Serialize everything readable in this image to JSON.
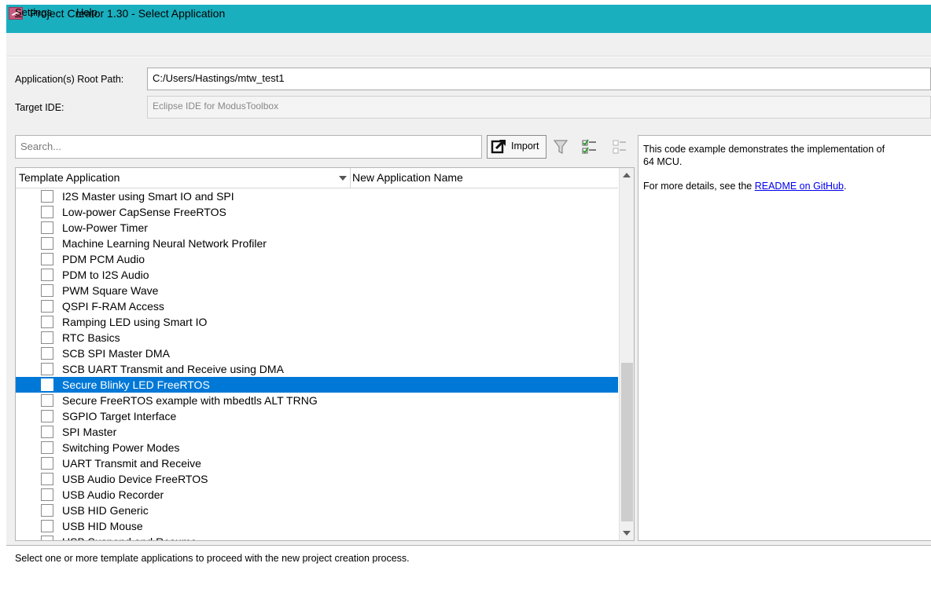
{
  "window": {
    "title": "Project Creator 1.30 - Select Application"
  },
  "menu": {
    "settings": {
      "underline": "S",
      "rest": "ettings"
    },
    "help": {
      "underline": "H",
      "rest": "elp"
    }
  },
  "form": {
    "root_path_label": "Application(s) Root Path:",
    "root_path_value": "C:/Users/Hastings/mtw_test1",
    "target_ide_label": "Target IDE:",
    "target_ide_value": "Eclipse IDE for ModusToolbox"
  },
  "toolbar": {
    "search_placeholder": "Search...",
    "import_label": "Import",
    "icons": [
      "import-icon",
      "filter-icon",
      "select-all-icon",
      "deselect-all-icon"
    ]
  },
  "table": {
    "headers": [
      "Template Application",
      "New Application Name"
    ],
    "rows": [
      {
        "label": "I2S Master using Smart IO and SPI",
        "selected": false
      },
      {
        "label": "Low-power CapSense FreeRTOS",
        "selected": false
      },
      {
        "label": "Low-Power Timer",
        "selected": false
      },
      {
        "label": "Machine Learning Neural Network Profiler",
        "selected": false
      },
      {
        "label": "PDM PCM Audio",
        "selected": false
      },
      {
        "label": "PDM to I2S Audio",
        "selected": false
      },
      {
        "label": "PWM Square Wave",
        "selected": false
      },
      {
        "label": "QSPI F-RAM Access",
        "selected": false
      },
      {
        "label": "Ramping LED using Smart IO",
        "selected": false
      },
      {
        "label": "RTC Basics",
        "selected": false
      },
      {
        "label": "SCB SPI Master DMA",
        "selected": false
      },
      {
        "label": "SCB UART Transmit and Receive using DMA",
        "selected": false
      },
      {
        "label": "Secure Blinky LED FreeRTOS",
        "selected": true
      },
      {
        "label": "Secure FreeRTOS example with mbedtls ALT TRNG",
        "selected": false
      },
      {
        "label": "SGPIO Target Interface",
        "selected": false
      },
      {
        "label": "SPI Master",
        "selected": false
      },
      {
        "label": "Switching Power Modes",
        "selected": false
      },
      {
        "label": "UART Transmit and Receive",
        "selected": false
      },
      {
        "label": "USB Audio Device FreeRTOS",
        "selected": false
      },
      {
        "label": "USB Audio Recorder",
        "selected": false
      },
      {
        "label": "USB HID Generic",
        "selected": false
      },
      {
        "label": "USB HID Mouse",
        "selected": false
      },
      {
        "label": "USB Suspend and Resume",
        "selected": false
      }
    ]
  },
  "description": {
    "line1": "This code example demonstrates the implementation of",
    "line2": "64 MCU.",
    "more_prefix": "For more details, see the ",
    "link_text": "README on GitHub",
    "more_suffix": "."
  },
  "status": {
    "message": "Select one or more template applications to proceed with the new project creation process."
  },
  "colors": {
    "titlebar": "#1aafbf",
    "selection": "#0078d7",
    "link": "#0000ee"
  }
}
